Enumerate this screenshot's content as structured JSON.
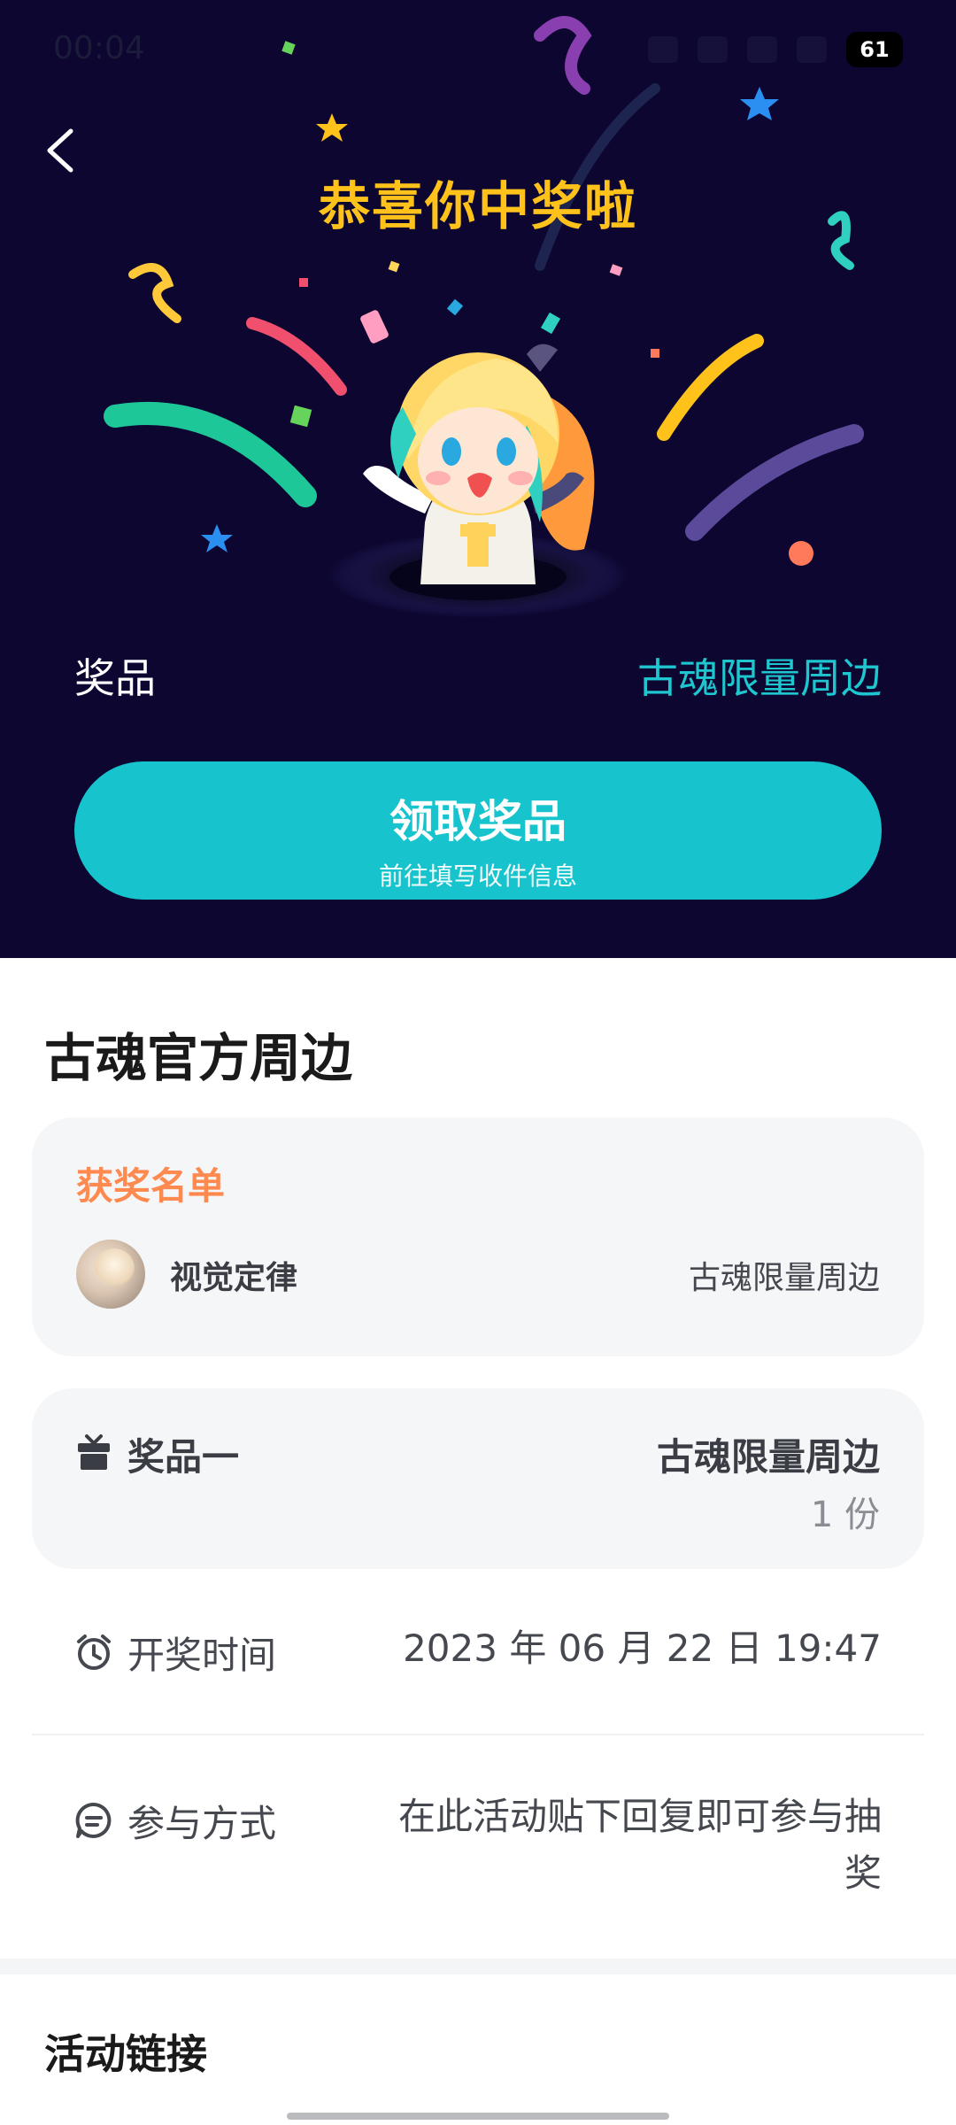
{
  "status_bar": {
    "time": "00:04",
    "battery": "61"
  },
  "hero": {
    "title": "恭喜你中奖啦",
    "prize_label": "奖品",
    "prize_value": "古魂限量周边",
    "claim_button": {
      "label": "领取奖品",
      "sub_label": "前往填写收件信息"
    },
    "colors": {
      "background": "#0c0630",
      "title": "#ffc21a",
      "accent": "#17c4cd"
    }
  },
  "section": {
    "title": "古魂官方周边"
  },
  "winners": {
    "title": "获奖名单",
    "items": [
      {
        "name": "视觉定律",
        "prize": "古魂限量周边"
      }
    ]
  },
  "prize_card": {
    "label": "奖品一",
    "name": "古魂限量周边",
    "count": "1 份"
  },
  "draw_time": {
    "label": "开奖时间",
    "value": "2023 年 06 月 22 日 19:47"
  },
  "participation": {
    "label": "参与方式",
    "value": "在此活动贴下回复即可参与抽奖"
  },
  "activity_link": {
    "title": "活动链接"
  },
  "icons": [
    "back-icon",
    "gift-icon",
    "alarm-clock-icon",
    "chat-bubble-icon"
  ]
}
